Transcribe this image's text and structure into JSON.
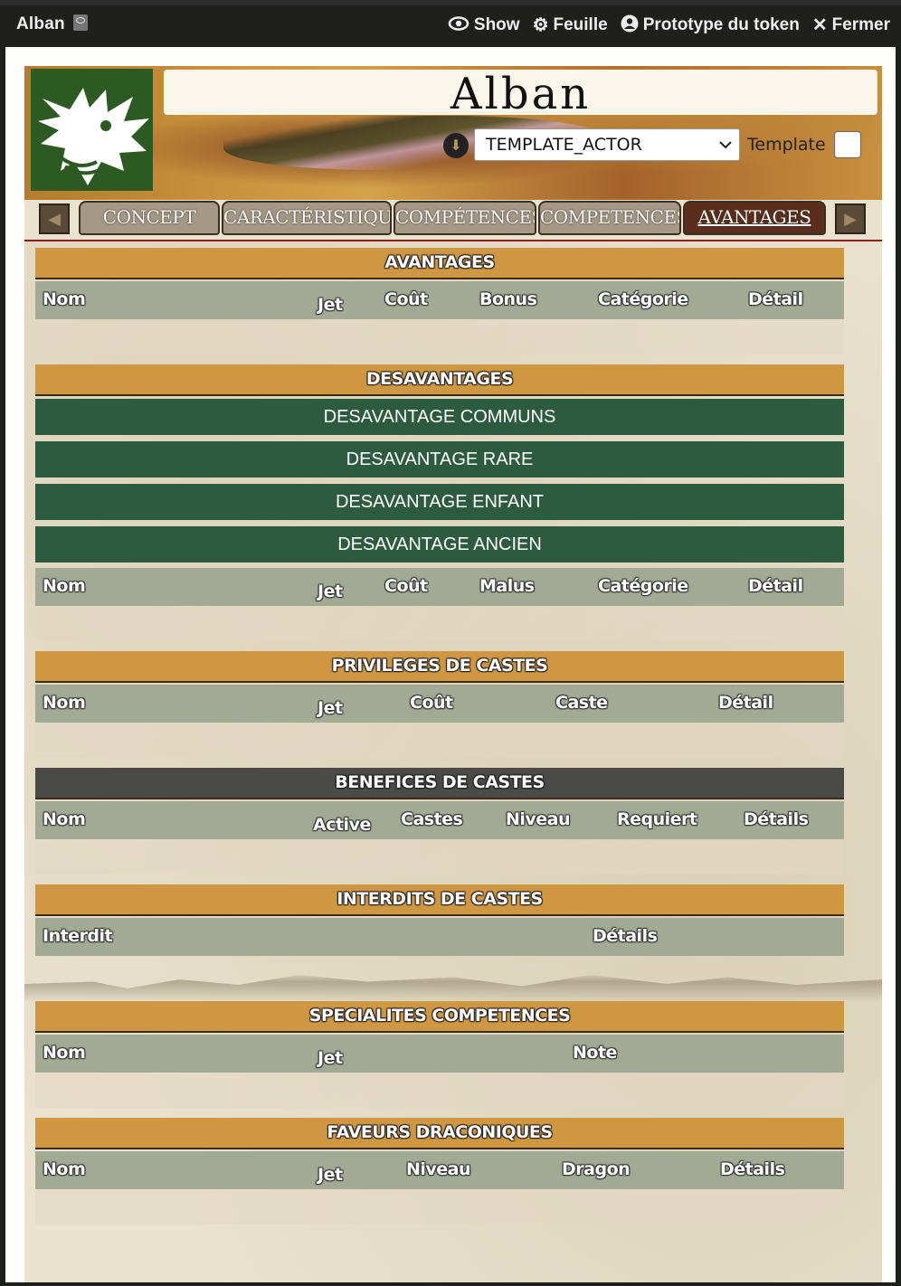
{
  "window": {
    "title": "Alban",
    "controls": {
      "show": "Show",
      "sheet": "Feuille",
      "token": "Prototype du token",
      "close": "Fermer"
    }
  },
  "character": {
    "name": "Alban",
    "actor_template": "TEMPLATE_ACTOR",
    "template_label": "Template"
  },
  "tabs": [
    "CONCEPT",
    "CARACTÉRISTIQUE",
    "COMPÉTENCES",
    "COMPETENCES",
    "AVANTAGES"
  ],
  "active_tab": "AVANTAGES",
  "sections": {
    "avantages": {
      "title": "AVANTAGES",
      "columns": [
        "Nom",
        "Jet",
        "Coût",
        "Bonus",
        "Catégorie",
        "Détail"
      ]
    },
    "desavantages": {
      "title": "DESAVANTAGES",
      "groups": [
        "DESAVANTAGE COMMUNS",
        "DESAVANTAGE RARE",
        "DESAVANTAGE ENFANT",
        "DESAVANTAGE ANCIEN"
      ],
      "columns": [
        "Nom",
        "Jet",
        "Coût",
        "Malus",
        "Catégorie",
        "Détail"
      ]
    },
    "privileges": {
      "title": "PRIVILEGES DE CASTES",
      "columns": [
        "Nom",
        "Jet",
        "Coût",
        "Caste",
        "Détail"
      ]
    },
    "benefices": {
      "title": "BENEFICES DE CASTES",
      "columns": [
        "Nom",
        "Active",
        "Castes",
        "Niveau",
        "Requiert",
        "Détails"
      ]
    },
    "interdits": {
      "title": "INTERDITS DE CASTES",
      "columns": [
        "Interdit",
        "Détails"
      ]
    },
    "specialites": {
      "title": "SPECIALITES COMPETENCES",
      "columns": [
        "Nom",
        "Jet",
        "Note"
      ]
    },
    "faveurs": {
      "title": "FAVEURS DRACONIQUES",
      "columns": [
        "Nom",
        "Jet",
        "Niveau",
        "Dragon",
        "Détails"
      ]
    }
  },
  "colors": {
    "section_title": "#cf9741",
    "subsection": "#2c5b40",
    "column_header": "#a3aa93",
    "logo": "#2c5a22",
    "active_tab": "#5b2d1c"
  }
}
